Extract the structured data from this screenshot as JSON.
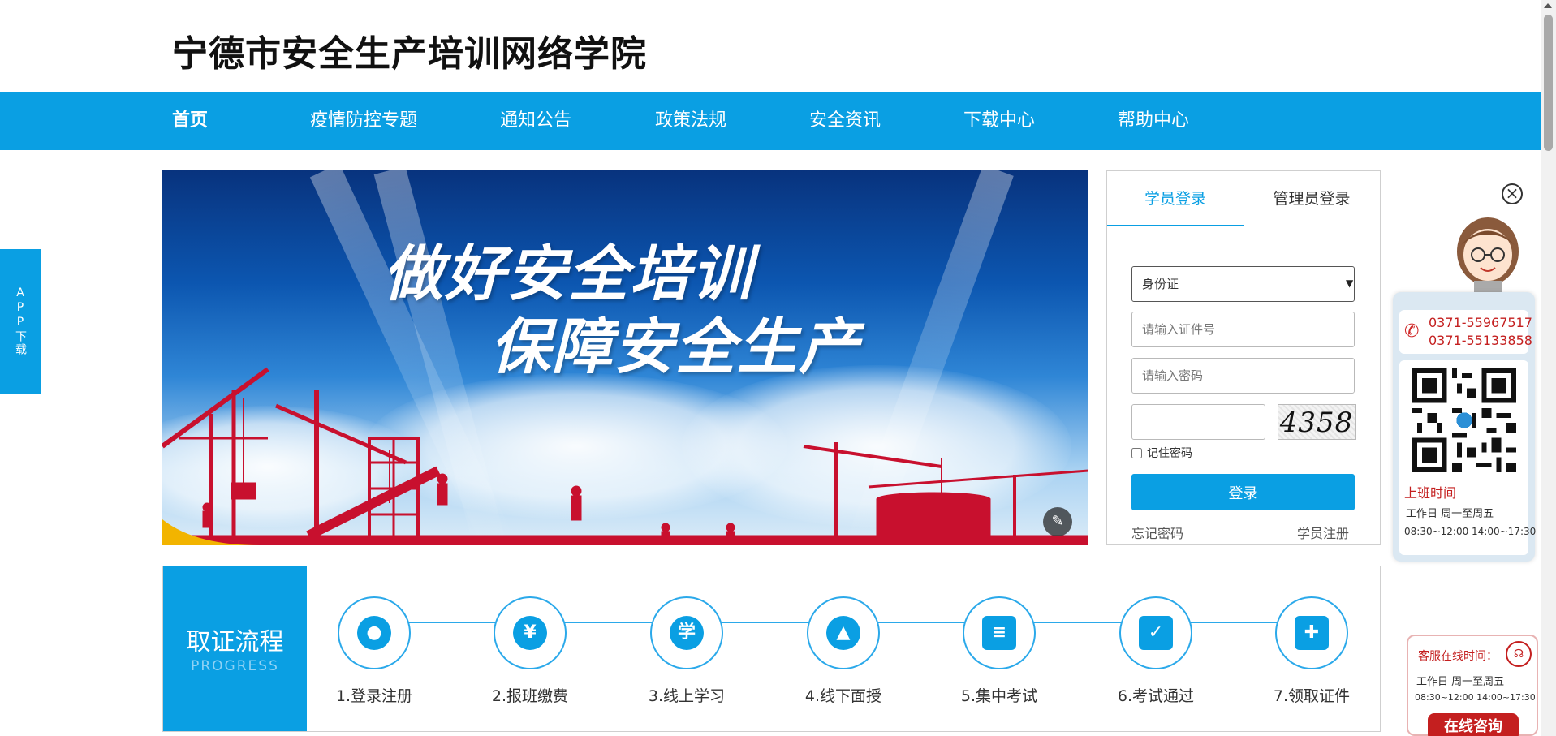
{
  "site": {
    "title": "宁德市安全生产培训网络学院"
  },
  "nav": {
    "items": [
      {
        "label": "首页",
        "active": true
      },
      {
        "label": "疫情防控专题"
      },
      {
        "label": "通知公告"
      },
      {
        "label": "政策法规"
      },
      {
        "label": "安全资讯"
      },
      {
        "label": "下载中心"
      },
      {
        "label": "帮助中心"
      }
    ]
  },
  "app_tab": {
    "label": "APP下载"
  },
  "banner": {
    "line1": "做好安全培训",
    "line2": "保障安全生产",
    "edit_icon": "magic-wand-icon"
  },
  "login": {
    "tabs": [
      {
        "label": "学员登录",
        "active": true
      },
      {
        "label": "管理员登录"
      }
    ],
    "id_type": {
      "selected": "身份证"
    },
    "id_placeholder": "请输入证件号",
    "password_placeholder": "请输入密码",
    "captcha_value": "",
    "captcha_text": "4358",
    "remember_label": "记住密码",
    "submit_label": "登录",
    "forgot_label": "忘记密码",
    "register_label": "学员注册"
  },
  "progress": {
    "title": "取证流程",
    "subtitle": "PROGRESS",
    "steps": [
      {
        "label": "1.登录注册",
        "icon": "user-icon",
        "glyph": "●"
      },
      {
        "label": "2.报班缴费",
        "icon": "yen-icon",
        "glyph": "¥"
      },
      {
        "label": "3.线上学习",
        "icon": "study-icon",
        "glyph": "学"
      },
      {
        "label": "4.线下面授",
        "icon": "classroom-icon",
        "glyph": "▲"
      },
      {
        "label": "5.集中考试",
        "icon": "exam-paper-icon",
        "glyph": "≡"
      },
      {
        "label": "6.考试通过",
        "icon": "document-check-icon",
        "glyph": "✓"
      },
      {
        "label": "7.领取证件",
        "icon": "certificate-icon",
        "glyph": "✚"
      }
    ]
  },
  "contact": {
    "phones": [
      "0371-55967517",
      "0371-55133858"
    ],
    "hours_title": "上班时间",
    "hours_days": "工作日  周一至周五",
    "hours_times": "08:30~12:00  14:00~17:30",
    "close_glyph": "×"
  },
  "online": {
    "title": "客服在线时间：",
    "days": "工作日  周一至周五",
    "times": "08:30~12:00  14:00~17:30",
    "button": "在线咨询"
  },
  "colors": {
    "accent": "#0a9fe3",
    "red": "#c41f1f"
  }
}
